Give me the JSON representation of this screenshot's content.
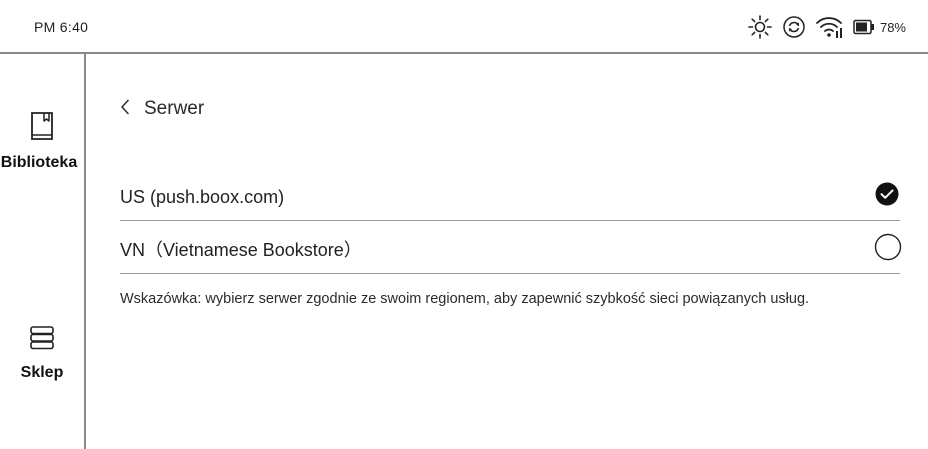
{
  "status_bar": {
    "time": "PM 6:40",
    "icons": [
      "brightness-icon",
      "sync-icon",
      "wifi-icon",
      "battery-icon"
    ],
    "battery_percent": "78%"
  },
  "sidebar": {
    "items": [
      {
        "label": "Biblioteka",
        "icon": "book-icon"
      },
      {
        "label": "Sklep",
        "icon": "books-stack-icon"
      }
    ]
  },
  "header": {
    "back_icon": "chevron-left-icon",
    "title": "Serwer"
  },
  "servers": [
    {
      "label": "US (push.boox.com)",
      "selected": true
    },
    {
      "label": "VN（Vietnamese Bookstore）",
      "selected": false
    }
  ],
  "hint": "Wskazówka: wybierz serwer zgodnie ze swoim regionem, aby zapewnić szybkość sieci powiązanych usług.",
  "colors": {
    "divider": "#8a8a8a",
    "text": "#222222",
    "selected_fill": "#111111"
  }
}
